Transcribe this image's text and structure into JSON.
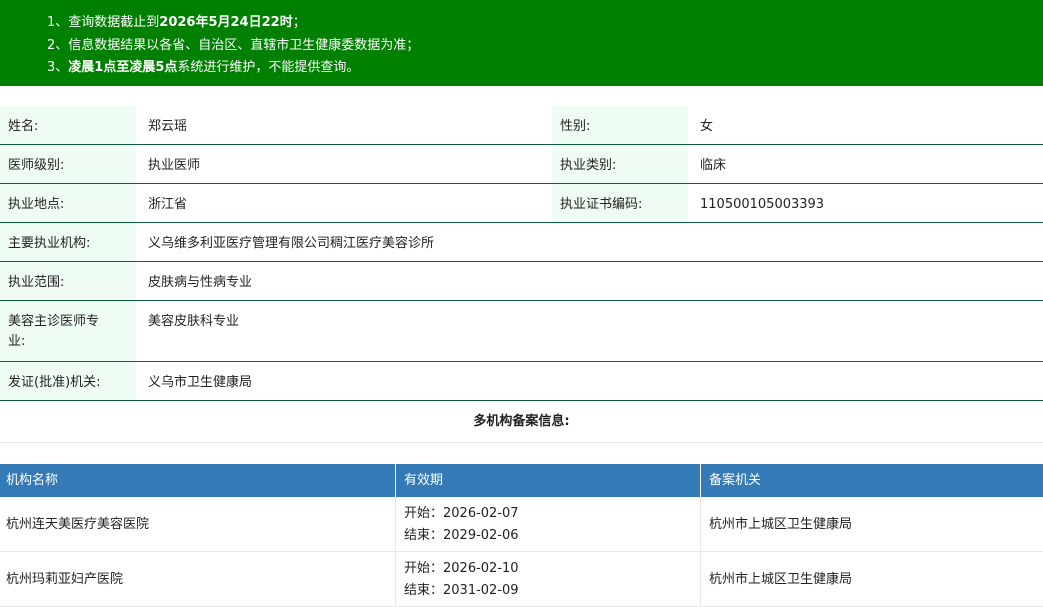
{
  "notice": {
    "line1_prefix": "1、查询数据截止到",
    "line1_bold": "2026年5月24日22时",
    "line1_suffix": "；",
    "line2": "2、信息数据结果以各省、自治区、直辖市卫生健康委数据为准；",
    "line3_prefix": "3、",
    "line3_bold": "凌晨1点至凌晨5点",
    "line3_suffix": "系统进行维护，不能提供查询。"
  },
  "doctor": {
    "name_label": "姓名:",
    "name": "郑云瑶",
    "gender_label": "性别:",
    "gender": "女",
    "level_label": "医师级别:",
    "level": "执业医师",
    "category_label": "执业类别:",
    "category": "临床",
    "location_label": "执业地点:",
    "location": "浙江省",
    "cert_label": "执业证书编码:",
    "cert_no": "110500105003393",
    "org_label": "主要执业机构:",
    "org": "义乌维多利亚医疗管理有限公司稠江医疗美容诊所",
    "scope_label": "执业范围:",
    "scope": "皮肤病与性病专业",
    "cosmetic_label_1": "美容主诊医师专",
    "cosmetic_label_2": "业:",
    "cosmetic": "美容皮肤科专业",
    "issuer_label": "发证(批准)机关:",
    "issuer": "义乌市卫生健康局"
  },
  "multi": {
    "title": "多机构备案信息:",
    "headers": {
      "name": "机构名称",
      "valid": "有效期",
      "authority": "备案机关"
    },
    "rows": [
      {
        "name": "杭州连天美医疗美容医院",
        "start": "开始：2026-02-07",
        "end": "结束：2029-02-06",
        "authority": "杭州市上城区卫生健康局"
      },
      {
        "name": "杭州玛莉亚妇产医院",
        "start": "开始：2026-02-10",
        "end": "结束：2031-02-09",
        "authority": "杭州市上城区卫生健康局"
      }
    ]
  },
  "colors": {
    "notice_bg": "#008000",
    "label_bg": "#effcf4",
    "row_border": "#0f5c3e",
    "table_header_bg": "#337ab7"
  }
}
